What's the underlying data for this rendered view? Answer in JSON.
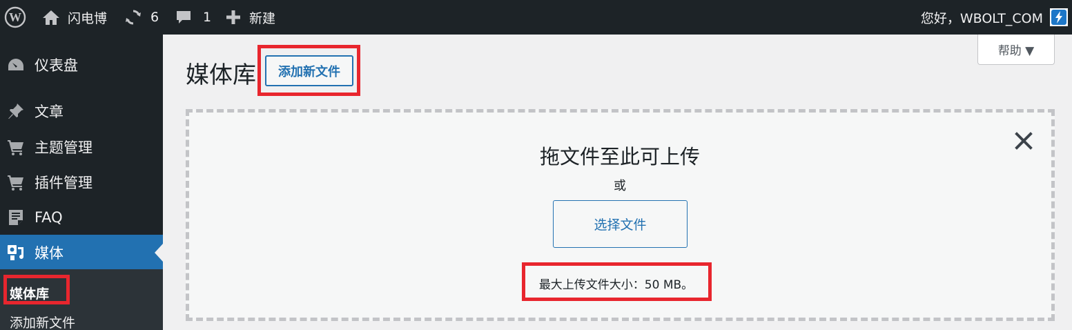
{
  "admin_bar": {
    "site_name": "闪电博",
    "updates_count": "6",
    "comments_count": "1",
    "new_label": "新建",
    "greeting": "您好，WBOLT_COM"
  },
  "sidebar": {
    "items": [
      {
        "label": "仪表盘",
        "icon": "dashboard-icon"
      },
      {
        "label": "文章",
        "icon": "pin-icon"
      },
      {
        "label": "主题管理",
        "icon": "cart-icon"
      },
      {
        "label": "插件管理",
        "icon": "cart-icon"
      },
      {
        "label": "FAQ",
        "icon": "document-icon"
      },
      {
        "label": "媒体",
        "icon": "media-icon"
      }
    ],
    "submenu": [
      {
        "label": "媒体库"
      },
      {
        "label": "添加新文件"
      }
    ]
  },
  "page": {
    "title": "媒体库",
    "add_new_label": "添加新文件",
    "help_label": "帮助 ▼"
  },
  "uploader": {
    "drop_title": "拖文件至此可上传",
    "or_text": "或",
    "select_files_label": "选择文件",
    "max_size_text": "最大上传文件大小：50 MB。"
  },
  "colors": {
    "admin_bar_bg": "#1d2327",
    "accent": "#2271b1",
    "highlight": "#e8262e"
  }
}
